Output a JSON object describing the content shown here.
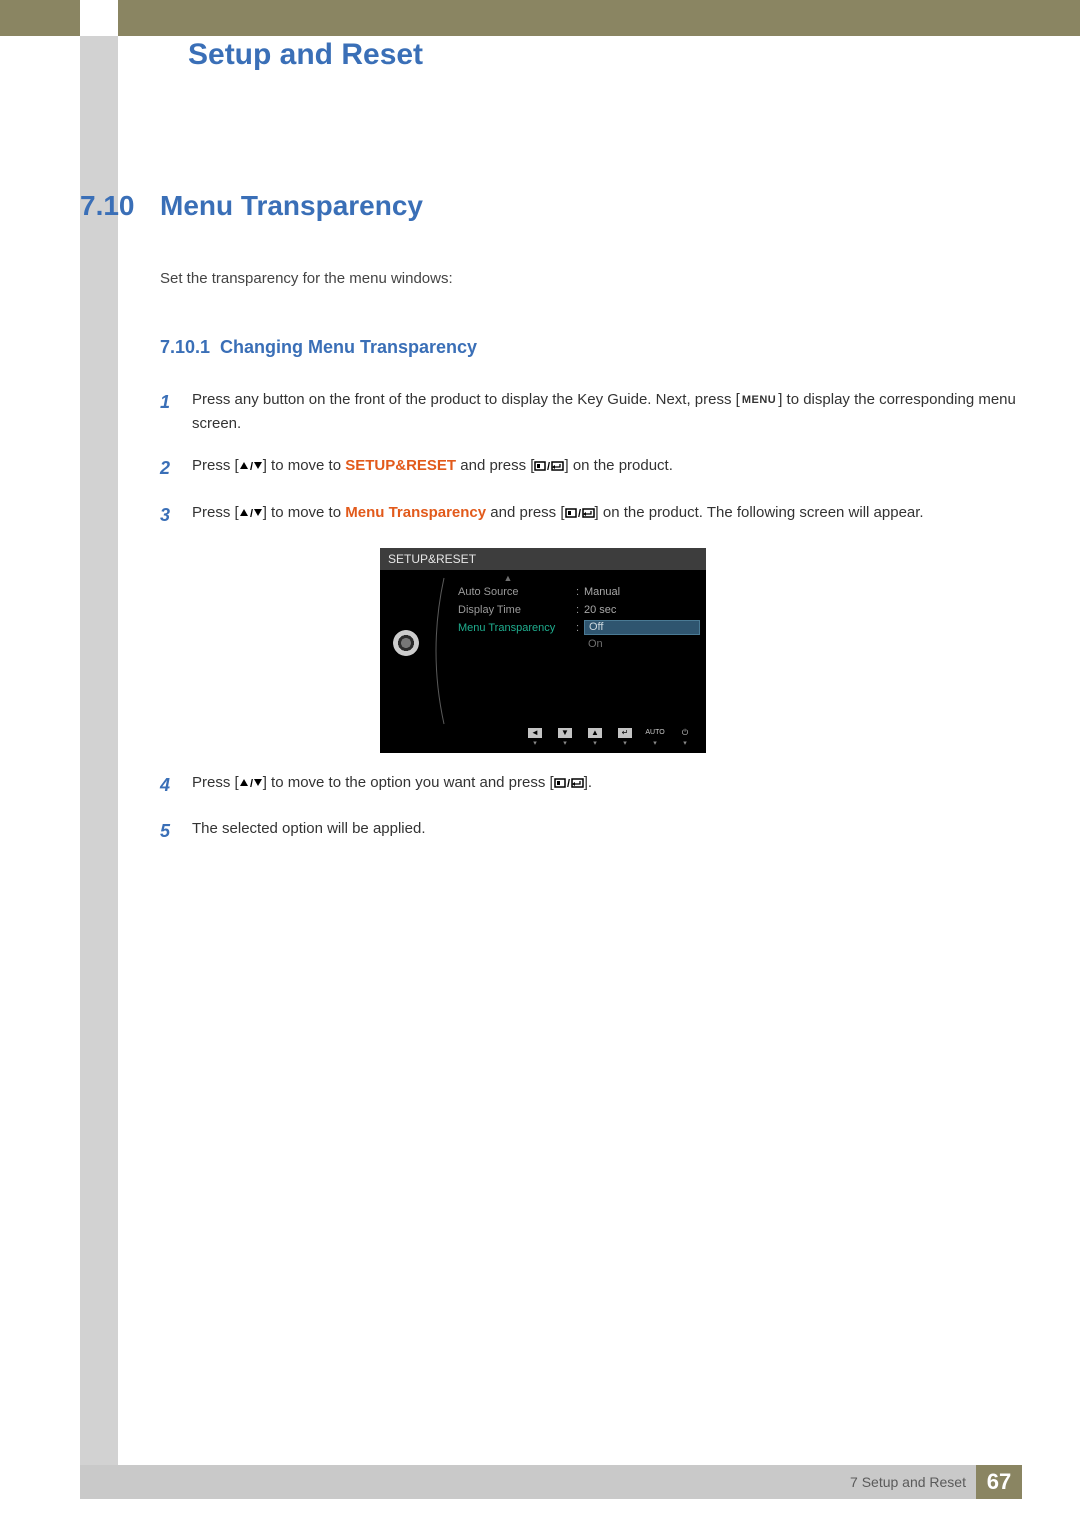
{
  "header": {
    "chapter_title": "Setup and Reset"
  },
  "section": {
    "number": "7.10",
    "title": "Menu Transparency"
  },
  "intro": "Set the transparency for the menu windows:",
  "subsection": {
    "number": "7.10.1",
    "title": "Changing Menu Transparency"
  },
  "steps": {
    "s1_a": "Press any button on the front of the product to display the Key Guide. Next, press [",
    "s1_menu": "MENU",
    "s1_b": "] to display the corresponding menu screen.",
    "s2_a": "Press [",
    "s2_b": "] to move to ",
    "s2_target": "SETUP&RESET",
    "s2_c": " and press [",
    "s2_d": "] on the product.",
    "s3_a": "Press [",
    "s3_b": "] to move to ",
    "s3_target": "Menu Transparency",
    "s3_c": " and press [",
    "s3_d": "] on the product. The following screen will appear.",
    "s4_a": "Press [",
    "s4_b": "] to move to the option you want and press [",
    "s4_c": "].",
    "s5": "The selected option will be applied."
  },
  "step_numbers": {
    "n1": "1",
    "n2": "2",
    "n3": "3",
    "n4": "4",
    "n5": "5"
  },
  "osd": {
    "title": "SETUP&RESET",
    "rows": {
      "auto_source": {
        "label": "Auto Source",
        "value": "Manual"
      },
      "display_time": {
        "label": "Display Time",
        "value": "20 sec"
      },
      "menu_transparency": {
        "label": "Menu Transparency",
        "selected": "Off",
        "option_on": "On"
      }
    },
    "nav": {
      "auto": "AUTO"
    }
  },
  "footer": {
    "chapter_ref": "7 Setup and Reset",
    "page": "67"
  }
}
